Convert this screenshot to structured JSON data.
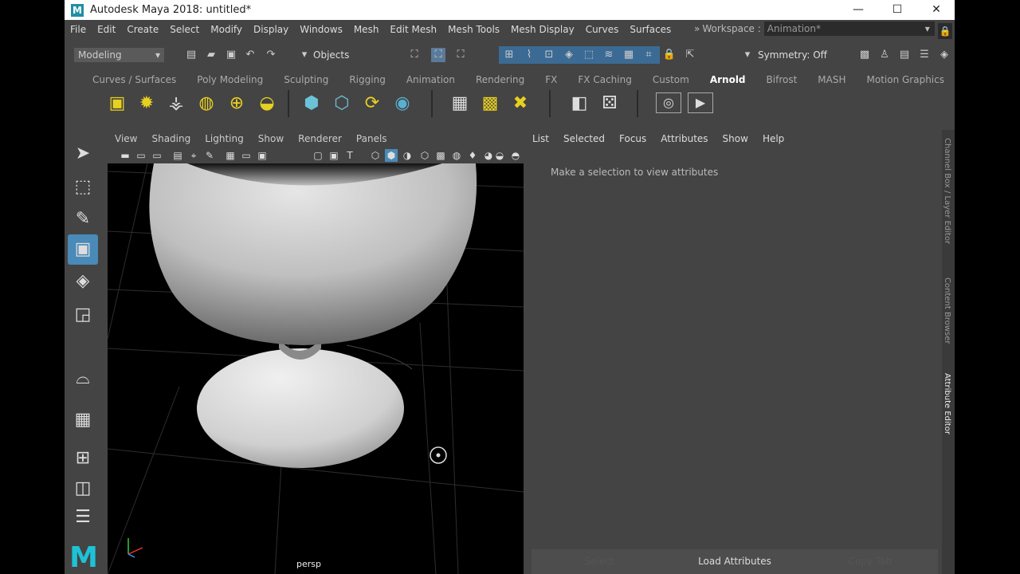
{
  "window": {
    "title": "Autodesk Maya 2018: untitled*",
    "logo": "M",
    "minimize": "—",
    "maximize": "☐",
    "close": "✕"
  },
  "menubar": {
    "items": [
      "File",
      "Edit",
      "Create",
      "Select",
      "Modify",
      "Display",
      "Windows",
      "Mesh",
      "Edit Mesh",
      "Mesh Tools",
      "Mesh Display",
      "Curves",
      "Surfaces"
    ],
    "workspace_label": "Workspace :",
    "workspace_value": "Animation*",
    "collapse_glyph": "»"
  },
  "statusline": {
    "mode": "Modeling",
    "objects_label": "Objects",
    "symmetry": "Symmetry: Off"
  },
  "shelf": {
    "tabs": [
      "Curves / Surfaces",
      "Poly Modeling",
      "Sculpting",
      "Rigging",
      "Animation",
      "Rendering",
      "FX",
      "FX Caching",
      "Custom",
      "Arnold",
      "Bifrost",
      "MASH",
      "Motion Graphics"
    ],
    "active_tab": "Arnold",
    "icons": [
      "area-light-icon",
      "mesh-light-icon",
      "photometric-light-icon",
      "skydome-light-icon",
      "physical-sky-icon",
      "light-portal-icon",
      "standin-icon",
      "volume-icon",
      "curve-collector-icon",
      "render-view-icon",
      "flush-texture-cache-icon",
      "flush-background-cache-icon",
      "txmanager-icon",
      "light-manager-icon",
      "render-icon",
      "ipr-icon"
    ]
  },
  "viewport": {
    "menu": [
      "View",
      "Shading",
      "Lighting",
      "Show",
      "Renderer",
      "Panels"
    ],
    "camera_label": "persp"
  },
  "attribute_editor": {
    "menu": [
      "List",
      "Selected",
      "Focus",
      "Attributes",
      "Show",
      "Help"
    ],
    "message": "Make a selection to view attributes",
    "buttons": {
      "select": "Select",
      "load": "Load Attributes",
      "copy_tab": "Copy Tab"
    }
  },
  "side_tabs": [
    "Channel Box / Layer Editor",
    "Content Browser",
    "Attribute Editor"
  ],
  "colors": {
    "panel_bg": "#444444",
    "accent": "#4a8ab8",
    "maya_logo": "#1ec2d6"
  }
}
